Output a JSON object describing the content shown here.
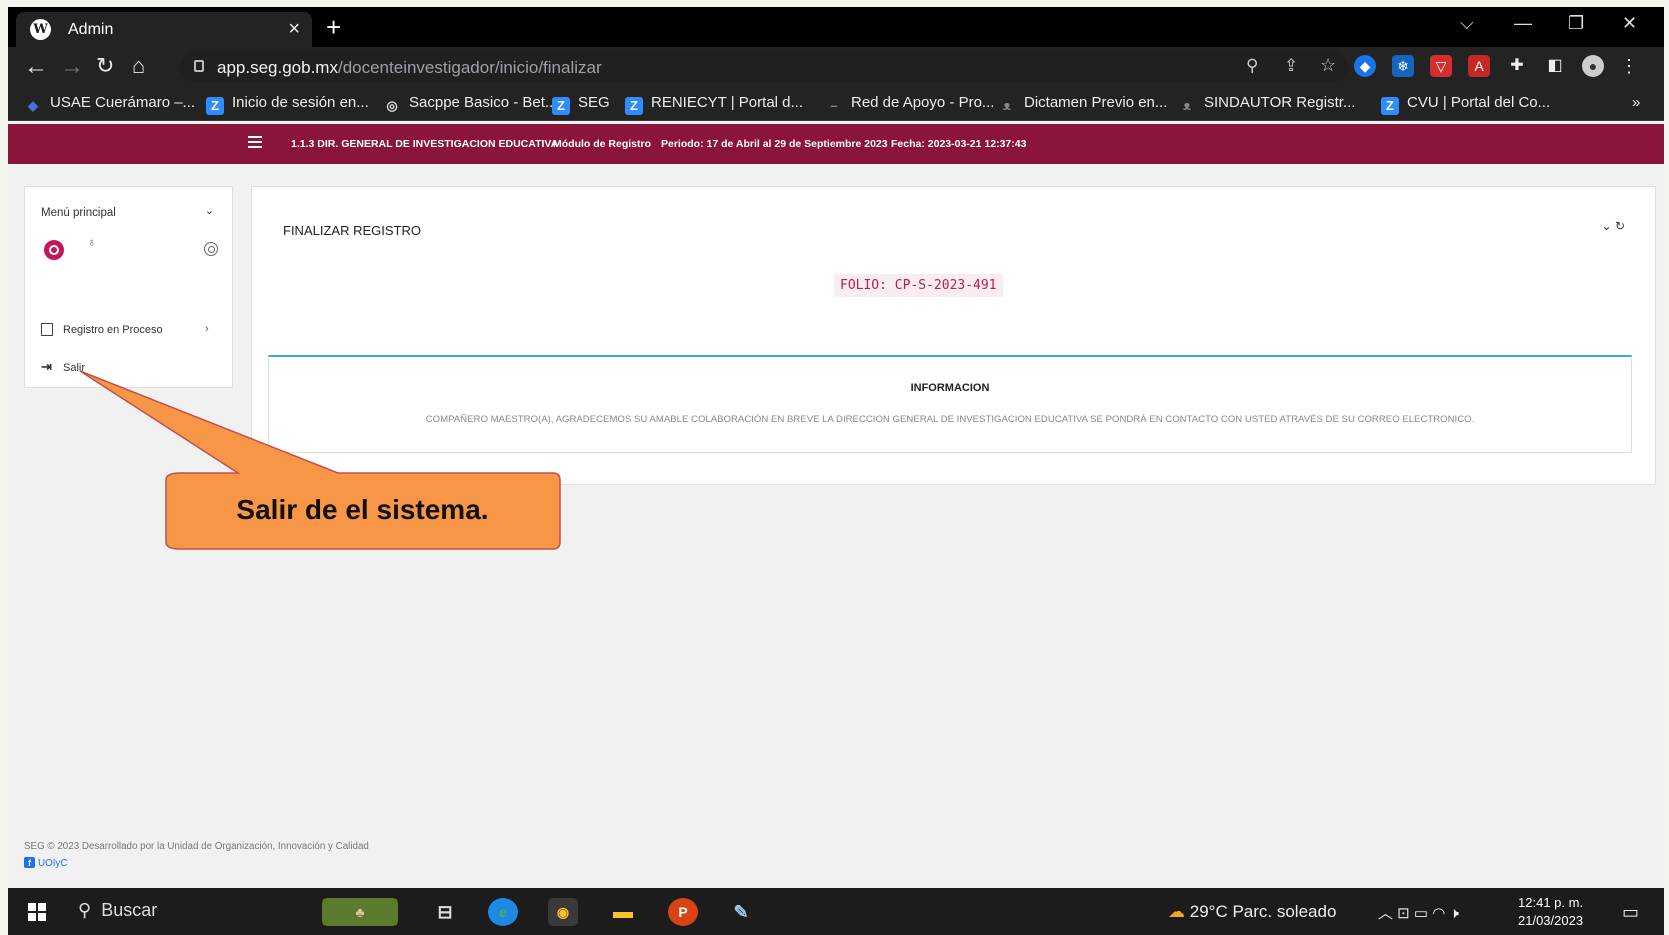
{
  "browser": {
    "tab_title": "Admin",
    "tab_close": "×",
    "new_tab": "+",
    "url_host": "app.seg.gob.mx",
    "url_path": "/docenteinvestigador/inicio/finalizar",
    "bookmarks": [
      {
        "label": "USAE Cuerámaro –...",
        "icon": "usae-icon",
        "color": "#4a6ee0"
      },
      {
        "label": "Inicio de sesión en...",
        "icon": "zoom-z-icon",
        "color": "#2d8cff"
      },
      {
        "label": "Sacppe Basico - Bet...",
        "icon": "globe-icon",
        "color": "#555"
      },
      {
        "label": "SEG",
        "icon": "zoom-z-icon",
        "color": "#2d8cff"
      },
      {
        "label": "RENIECYT | Portal d...",
        "icon": "zoom-z-icon",
        "color": "#2d8cff"
      },
      {
        "label": "Red de Apoyo - Pro...",
        "icon": "dash-icon",
        "color": "#888"
      },
      {
        "label": "Dictamen Previo en...",
        "icon": "eagle-icon",
        "color": "#888"
      },
      {
        "label": "SINDAUTOR Registr...",
        "icon": "eagle-icon",
        "color": "#888"
      },
      {
        "label": "CVU | Portal del Co...",
        "icon": "zoom-z-icon",
        "color": "#2d8cff"
      }
    ],
    "more_bookmarks": "»"
  },
  "topbar": {
    "org": "1.1.3 DIR. GENERAL DE INVESTIGACION EDUCATIVA",
    "module": "Módulo de Registro",
    "period": "Periodo: 17 de Abril al 29 de Septiembre 2023",
    "date": "Fecha: 2023-03-21 12:37:43"
  },
  "sidebar": {
    "heading": "Menú principal",
    "items": [
      {
        "label": "Registro en Proceso",
        "icon": "document-icon"
      },
      {
        "label": "Salir",
        "icon": "logout-icon"
      }
    ]
  },
  "main": {
    "title": "FINALIZAR REGISTRO",
    "folio": "FOLIO: CP-S-2023-491",
    "info_heading": "INFORMACION",
    "info_text": "COMPAÑERO MAESTRO(A), AGRADECEMOS SU AMABLE COLABORACIÓN EN BREVE LA DIRECCION GENERAL DE INVESTIGACION EDUCATIVA SE PONDRÁ EN CONTACTO CON USTED ATRAVÉS DE SU CORREO ELECTRONICO."
  },
  "footer": {
    "text": "SEG © 2023 Desarrollado por la Unidad de Organización, Innovación y Calidad",
    "link": "UOIyC"
  },
  "callout": {
    "text": "Salir de el sistema.",
    "fill": "#f79646",
    "stroke": "#c0504d"
  },
  "taskbar": {
    "search": "Buscar",
    "weather": "29°C  Parc. soleado",
    "time": "12:41 p. m.",
    "date": "21/03/2023"
  }
}
